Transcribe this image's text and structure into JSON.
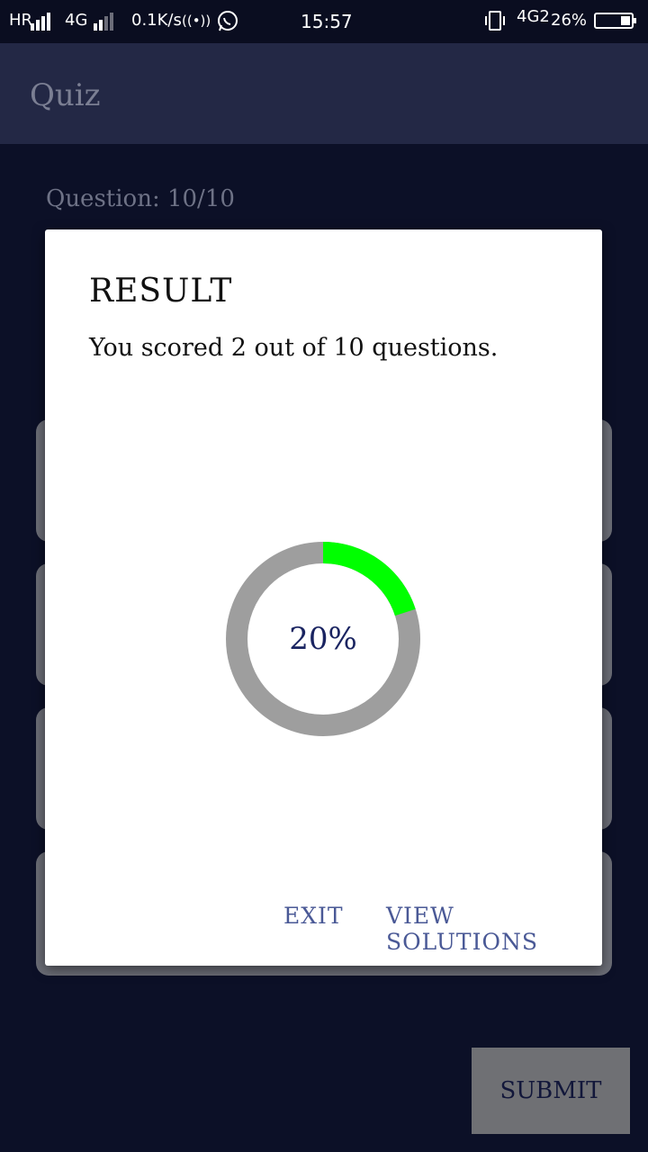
{
  "status_bar": {
    "network_left": "HR",
    "network_4g": "4G",
    "speed": "0.1K/s",
    "hotspot": "((•))",
    "whatsapp_icon": "whatsapp-icon",
    "time": "15:57",
    "vibrate_icon": "vibrate-icon",
    "network_4g2": "4G2",
    "battery": "26%",
    "battery_level": 0.26
  },
  "app_bar": {
    "title": "Quiz"
  },
  "quiz": {
    "question_counter": "Question: 10/10",
    "submit_label": "SUBMIT"
  },
  "dialog": {
    "title": "RESULT",
    "message": "You scored 2 out of 10 questions.",
    "progress_text": "20%",
    "progress_fraction": 0.2,
    "colors": {
      "progress": "#00ff00",
      "track": "#9e9e9e"
    },
    "exit_label": "EXIT",
    "view_solutions_label": "VIEW SOLUTIONS"
  }
}
